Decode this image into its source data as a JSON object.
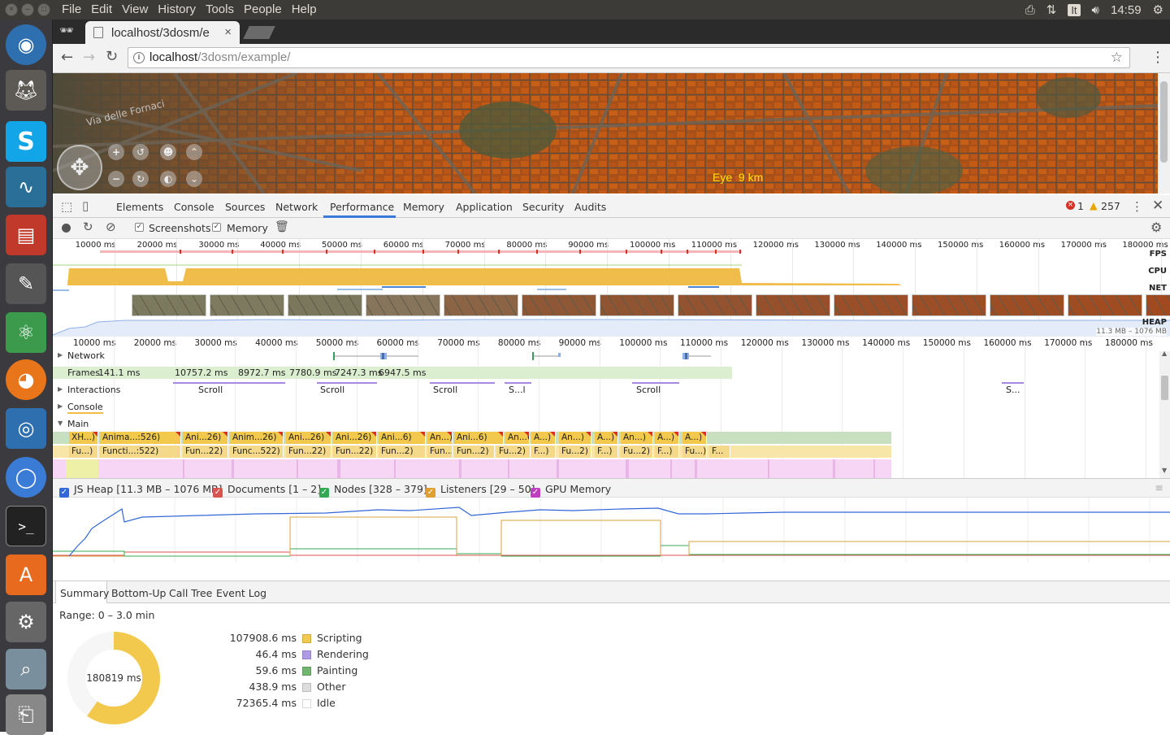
{
  "os": {
    "menu": [
      "File",
      "Edit",
      "View",
      "History",
      "Tools",
      "People",
      "Help"
    ],
    "keyboard": "It",
    "clock": "14:59"
  },
  "browser": {
    "tab_title": "localhost/3dosm/e",
    "url_host": "localhost",
    "url_path": "/3dosm/example/"
  },
  "map": {
    "eye_label": "Eye",
    "eye_value": "9 km",
    "street_label": "Via delle Fornaci"
  },
  "devtools": {
    "tabs": [
      "Elements",
      "Console",
      "Sources",
      "Network",
      "Performance",
      "Memory",
      "Application",
      "Security",
      "Audits"
    ],
    "active_tab": "Performance",
    "errors": "1",
    "warnings": "257",
    "screenshots_label": "Screenshots",
    "memory_label": "Memory",
    "overview_ticks": [
      "10000 ms",
      "20000 ms",
      "30000 ms",
      "40000 ms",
      "50000 ms",
      "60000 ms",
      "70000 ms",
      "80000 ms",
      "90000 ms",
      "100000 ms",
      "110000 ms",
      "120000 ms",
      "130000 ms",
      "140000 ms",
      "150000 ms",
      "160000 ms",
      "170000 ms",
      "180000 ms"
    ],
    "track_labels": {
      "fps": "FPS",
      "cpu": "CPU",
      "net": "NET",
      "heap": "HEAP"
    },
    "heap_range": "11.3 MB – 1076 MB",
    "rows": {
      "network": "Network",
      "frames": "Frames",
      "interactions": "Interactions",
      "console": "Console",
      "main": "Main"
    },
    "frames": [
      "141.1 ms",
      "10757.2 ms",
      "8972.7 ms",
      "7780.9 ms",
      "7247.3 ms",
      "6947.5 ms"
    ],
    "interactions": [
      "Scroll",
      "Scroll",
      "Scroll",
      "S...l",
      "Scroll",
      "S..."
    ],
    "main_row1": [
      "XH...)",
      "Anima...:526)",
      "Ani...26)",
      "Anim...26)",
      "Ani...26)",
      "Ani...26)",
      "Ani...6)",
      "An...)",
      "Ani...6)",
      "An...6)",
      "A...)",
      "An...)",
      "A...)",
      "An...)",
      "A...)",
      "A...)"
    ],
    "main_row2": [
      "Fu...)",
      "Functi...:522)",
      "Fun...22)",
      "Func...522)",
      "Fun...22)",
      "Fun...22)",
      "Fun...2)",
      "Fun...2)",
      "Fun...2)",
      "Fu...2)",
      "F...)",
      "Fu...2)",
      "F...)",
      "Fu...2)",
      "F...)",
      "Fu...)",
      "F..."
    ],
    "memory_counters": [
      {
        "label": "JS Heap [11.3 MB – 1076 MB]",
        "color": "#3367d6"
      },
      {
        "label": "Documents [1 – 2]",
        "color": "#d9534f"
      },
      {
        "label": "Nodes [328 – 379]",
        "color": "#34a853"
      },
      {
        "label": "Listeners [29 – 50]",
        "color": "#e0a030"
      },
      {
        "label": "GPU Memory",
        "color": "#c03fc0"
      }
    ],
    "bottom_tabs": [
      "Summary",
      "Bottom-Up",
      "Call Tree",
      "Event Log"
    ],
    "range": "Range: 0 – 3.0 min",
    "total": "180819 ms",
    "summary": [
      {
        "value": "107908.6 ms",
        "name": "Scripting",
        "color": "#f2c94c"
      },
      {
        "value": "46.4 ms",
        "name": "Rendering",
        "color": "#af9ae8"
      },
      {
        "value": "59.6 ms",
        "name": "Painting",
        "color": "#71b56e"
      },
      {
        "value": "438.9 ms",
        "name": "Other",
        "color": "#dddddd"
      },
      {
        "value": "72365.4 ms",
        "name": "Idle",
        "color": "#ffffff"
      }
    ]
  }
}
